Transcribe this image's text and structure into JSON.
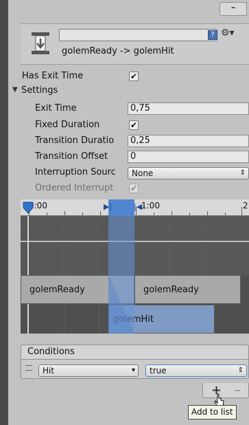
{
  "window": {
    "minimize_label": "–"
  },
  "transition": {
    "name_value": "",
    "help_icon": "help-book-icon",
    "settings_icon": "gear-icon",
    "subtitle": "golemReady -> golemHit"
  },
  "props": {
    "has_exit_time_label": "Has Exit Time",
    "has_exit_time": true,
    "settings_label": "Settings",
    "exit_time_label": "Exit Time",
    "exit_time_value": "0,75",
    "fixed_duration_label": "Fixed Duration",
    "fixed_duration": true,
    "transition_duration_label": "Transition Duratio",
    "transition_duration_value": "0,25",
    "transition_offset_label": "Transition Offset",
    "transition_offset_value": "0",
    "interruption_source_label": "Interruption Sourc",
    "interruption_source_value": "None",
    "ordered_interruption_label": "Ordered Interrupt",
    "ordered_interruption": true
  },
  "timeline": {
    "ruler_labels": [
      "0:00",
      "1:00",
      "2"
    ],
    "bars": {
      "source_1": "golemReady",
      "source_2": "golemReady",
      "dest": "golemHit"
    }
  },
  "conditions": {
    "header": "Conditions",
    "rows": [
      {
        "parameter": "Hit",
        "value": "true"
      }
    ],
    "add_label": "+",
    "remove_label": "–",
    "tooltip": "Add to list"
  }
}
